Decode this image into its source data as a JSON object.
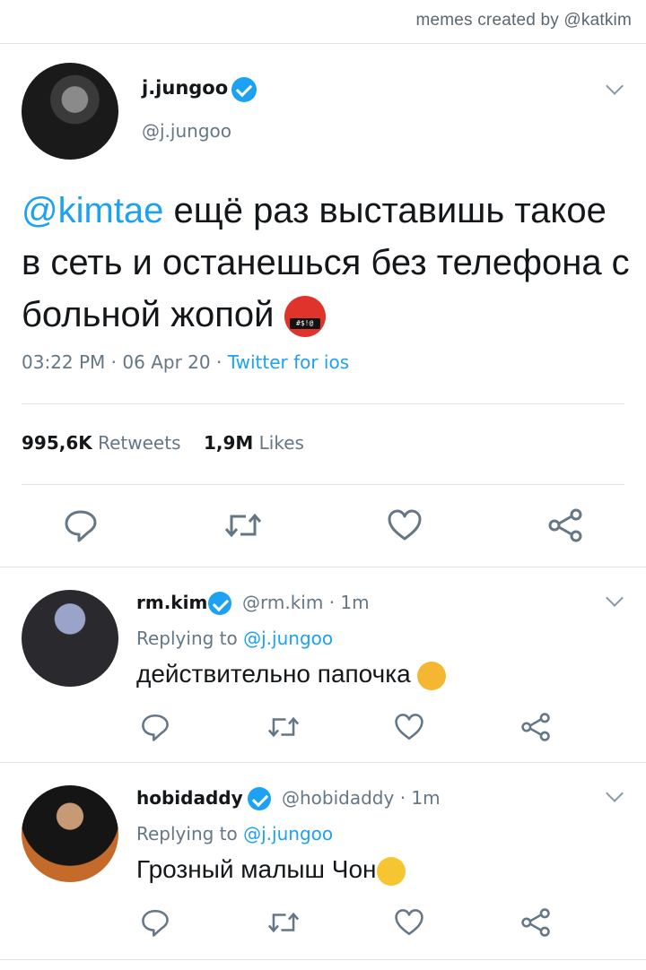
{
  "credit": "memes created by @katkim",
  "main_tweet": {
    "display_name": "j.jungoo",
    "handle": "@j.jungoo",
    "mention": "@kimtae",
    "text": "ещё раз выставишь такое в сеть и останешься без телефона с больной жопой",
    "emoji_icon": "angry-symbols-face-icon",
    "emoji_label": "#$!@",
    "time": "03:22 PM",
    "date": "06 Apr 20",
    "source": "Twitter for ios",
    "retweets_count": "995,6K",
    "retweets_label": "Retweets",
    "likes_count": "1,9M",
    "likes_label": "Likes"
  },
  "replies": [
    {
      "display_name": "rm.kim",
      "handle": "@rm.kim",
      "age": "1m",
      "replying_label": "Replying to",
      "replying_to": "@j.jungoo",
      "text": "действительно папочка",
      "emoji_icon": "dizzy-face-icon"
    },
    {
      "display_name": "hobidaddy",
      "handle": "@hobidaddy",
      "age": "1m",
      "replying_label": "Replying to",
      "replying_to": "@j.jungoo",
      "text": "Грозный малыш Чон",
      "emoji_icon": "kissing-face-icon"
    }
  ],
  "colors": {
    "accent": "#1da1f2",
    "secondary_text": "#657786",
    "divider": "#dfe4e8"
  }
}
